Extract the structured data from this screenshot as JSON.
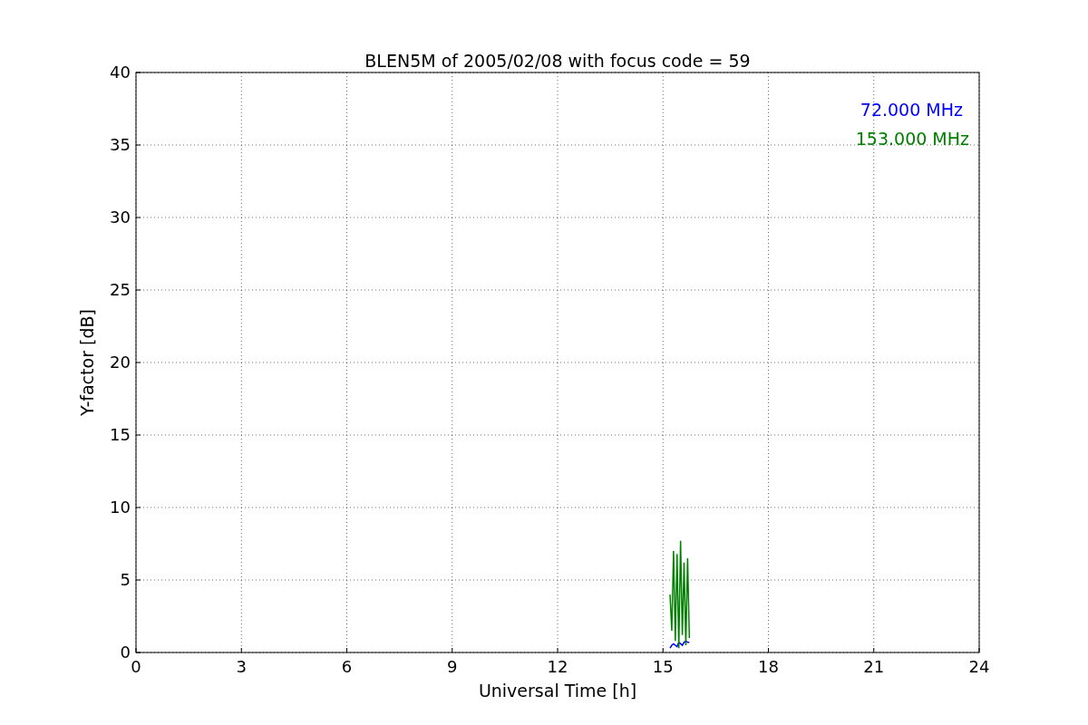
{
  "chart_data": {
    "type": "line",
    "title": "BLEN5M of 2005/02/08 with focus code = 59",
    "xlabel": "Universal Time [h]",
    "ylabel": "Y-factor [dB]",
    "x": [
      15.2,
      15.25,
      15.3,
      15.35,
      15.4,
      15.45,
      15.5,
      15.55,
      15.6,
      15.65,
      15.7,
      15.75
    ],
    "series": [
      {
        "name": "72.000 MHz",
        "color": "#0000ff",
        "values": [
          0.3,
          0.5,
          0.6,
          0.5,
          0.4,
          0.7,
          0.6,
          0.5,
          0.7,
          0.8,
          0.7,
          0.7
        ]
      },
      {
        "name": "153.000 MHz",
        "color": "#008000",
        "values": [
          4,
          1.5,
          7,
          0.8,
          6.8,
          0.3,
          7.7,
          1.2,
          6.2,
          0.5,
          6.5,
          1
        ]
      }
    ],
    "xlim": [
      0,
      24
    ],
    "ylim": [
      0,
      40
    ],
    "xticks": [
      0,
      3,
      6,
      9,
      12,
      15,
      18,
      21,
      24
    ],
    "yticks": [
      0,
      5,
      10,
      15,
      20,
      25,
      30,
      35,
      40
    ],
    "grid": true
  }
}
